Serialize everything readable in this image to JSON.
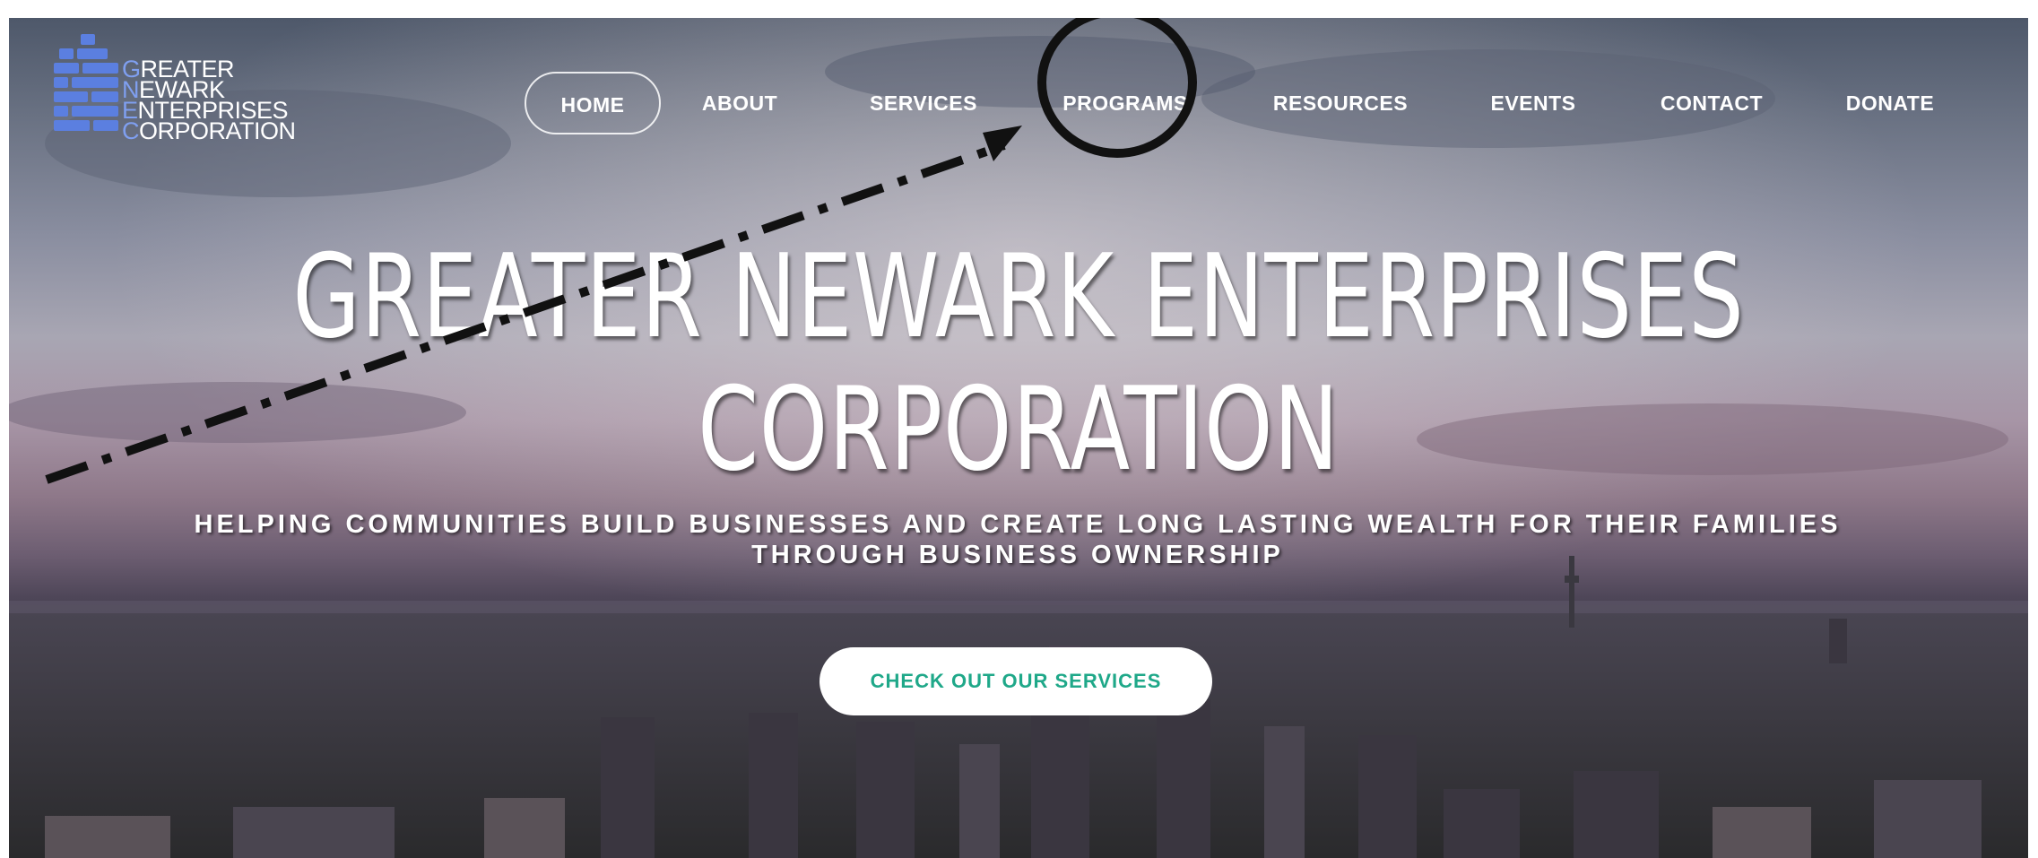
{
  "logo": {
    "lines": [
      {
        "cap": "G",
        "rest": "REATER"
      },
      {
        "cap": "N",
        "rest": "EWARK"
      },
      {
        "cap": "E",
        "rest": "NTERPRISES"
      },
      {
        "cap": "C",
        "rest": "ORPORATION"
      }
    ]
  },
  "nav": {
    "items": [
      {
        "label": "HOME",
        "active": true
      },
      {
        "label": "ABOUT"
      },
      {
        "label": "SERVICES"
      },
      {
        "label": "PROGRAMS"
      },
      {
        "label": "RESOURCES"
      },
      {
        "label": "EVENTS"
      },
      {
        "label": "CONTACT"
      },
      {
        "label": "DONATE"
      }
    ]
  },
  "hero": {
    "title_line1": "GREATER NEWARK ENTERPRISES",
    "title_line2": "CORPORATION",
    "subtitle_line1": "HELPING COMMUNITIES BUILD BUSINESSES AND CREATE LONG LASTING WEALTH FOR THEIR FAMILIES",
    "subtitle_line2": "THROUGH BUSINESS OWNERSHIP",
    "cta_label": "CHECK OUT OUR SERVICES"
  },
  "colors": {
    "accent": "#1fa889",
    "logo_cap": "#7f9ff0",
    "logo_mark": "#5b7fe0",
    "nav_text": "#ffffff"
  }
}
